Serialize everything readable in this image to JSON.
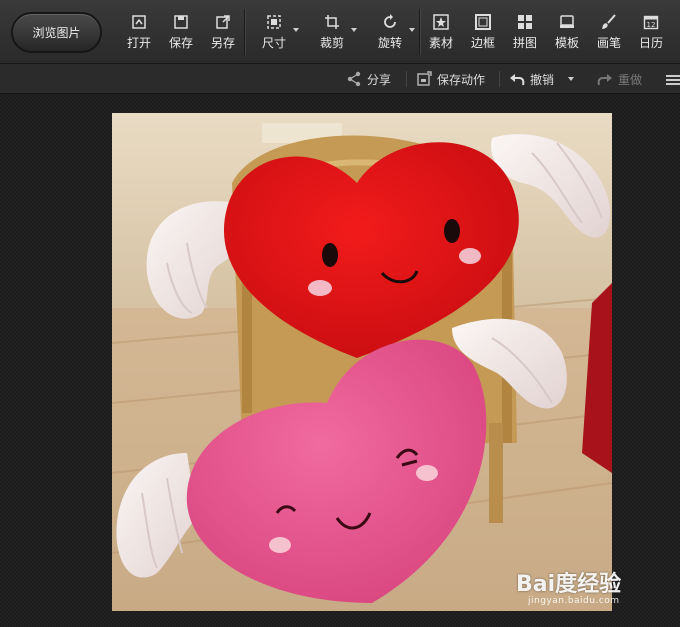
{
  "toolbar": {
    "browse_label": "浏览图片",
    "tools": [
      {
        "label": "打开",
        "icon": "open-icon"
      },
      {
        "label": "保存",
        "icon": "save-icon"
      },
      {
        "label": "另存",
        "icon": "save-as-icon"
      },
      {
        "label": "尺寸",
        "icon": "resize-icon",
        "dropdown": true
      },
      {
        "label": "裁剪",
        "icon": "crop-icon",
        "dropdown": true
      },
      {
        "label": "旋转",
        "icon": "rotate-icon",
        "dropdown": true
      },
      {
        "label": "素材",
        "icon": "material-icon"
      },
      {
        "label": "边框",
        "icon": "frame-icon"
      },
      {
        "label": "拼图",
        "icon": "collage-icon"
      },
      {
        "label": "模板",
        "icon": "template-icon"
      },
      {
        "label": "画笔",
        "icon": "brush-icon"
      },
      {
        "label": "日历",
        "icon": "calendar-icon"
      }
    ],
    "calendar_day": "12"
  },
  "subbar": {
    "share_label": "分享",
    "save_action_label": "保存动作",
    "undo_label": "撤销",
    "redo_label": "重做"
  },
  "watermark": {
    "brand": "Bai度经验",
    "url": "jingyan.baidu.com"
  },
  "colors": {
    "toolbar_bg": "#333333",
    "canvas_bg": "#1c1c1c",
    "text": "#eaeaea"
  }
}
